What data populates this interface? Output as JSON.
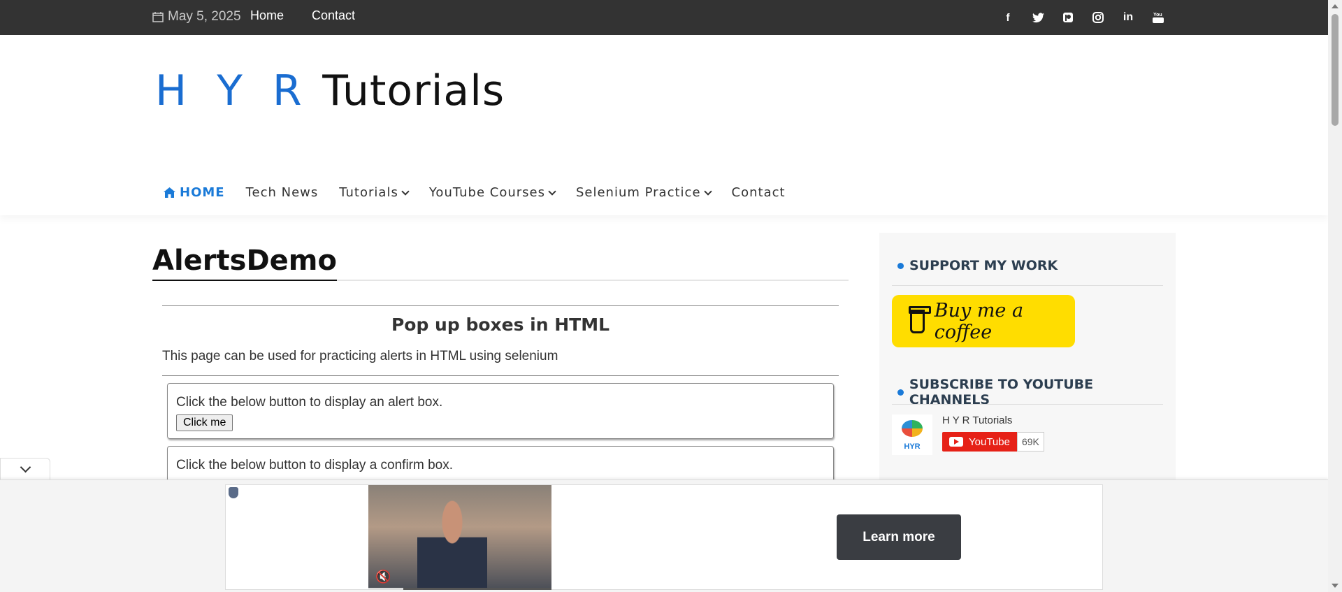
{
  "topbar": {
    "date": "May 5, 2025",
    "links": [
      "Home",
      "Contact"
    ],
    "social_icons": [
      "facebook-icon",
      "twitter-icon",
      "patreon-icon",
      "instagram-icon",
      "linkedin-icon",
      "youtube-icon"
    ]
  },
  "logo": {
    "part1": "H Y R",
    "part2": "Tutorials"
  },
  "nav": {
    "home": "HOME",
    "tech_news": "Tech News",
    "tutorials": "Tutorials",
    "youtube_courses": "YouTube Courses",
    "selenium_practice": "Selenium Practice",
    "contact": "Contact"
  },
  "page": {
    "title": "AlertsDemo",
    "heading": "Pop up boxes in HTML",
    "description": "This page can be used for practicing alerts in HTML using selenium",
    "boxes": [
      {
        "text": "Click the below button to display an alert box.",
        "button": "Click me"
      },
      {
        "text": "Click the below button to display a confirm box.",
        "button": ""
      }
    ]
  },
  "sidebar": {
    "support_title": "SUPPORT MY WORK",
    "coffee_label": "Buy me a coffee",
    "subscribe_title": "SUBSCRIBE TO YOUTUBE CHANNELS",
    "channel_name": "H Y R Tutorials",
    "channel_logo_text": "HYR",
    "youtube_label": "YouTube",
    "subscriber_count": "69K"
  },
  "ad": {
    "learn_more": "Learn more"
  },
  "colors": {
    "topbar_bg": "#333333",
    "accent": "#1a7ad8",
    "coffee_yellow": "#ffdd00",
    "youtube_red": "#e62117"
  }
}
